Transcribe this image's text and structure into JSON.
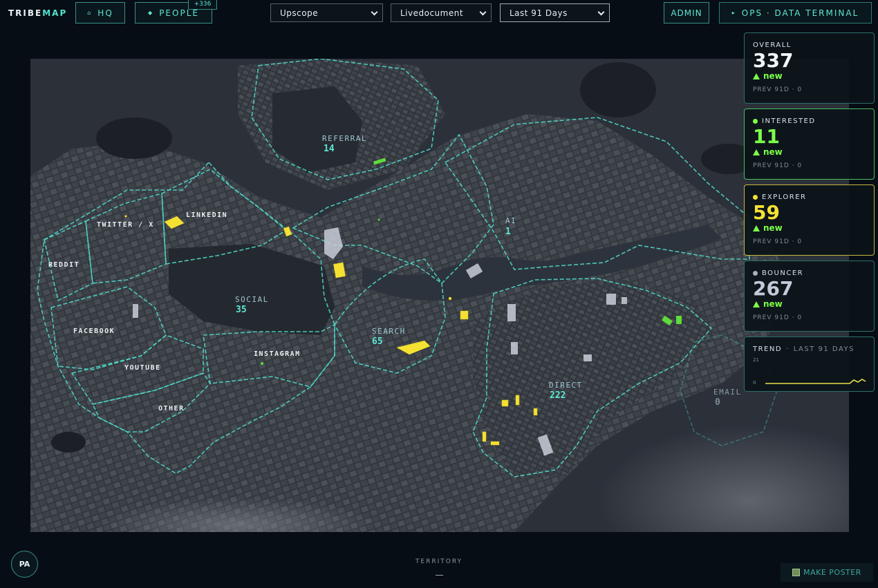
{
  "app": {
    "logo_primary": "TRIBE",
    "logo_accent": "MAP"
  },
  "nav": {
    "hq_label": "HQ",
    "people_label": "PEOPLE",
    "people_badge": "+336",
    "admin_label": "ADMIN",
    "ops_label": "OPS · DATA TERMINAL"
  },
  "filters": {
    "source": "Upscope",
    "document": "Livedocument",
    "range": "Last 91 Days"
  },
  "map": {
    "zones": [
      {
        "name": "REFERRAL",
        "count": "14"
      },
      {
        "name": "LINKEDIN",
        "count": ""
      },
      {
        "name": "TWITTER / X",
        "count": ""
      },
      {
        "name": "REDDIT",
        "count": ""
      },
      {
        "name": "FACEBOOK",
        "count": ""
      },
      {
        "name": "YOUTUBE",
        "count": ""
      },
      {
        "name": "OTHER",
        "count": ""
      },
      {
        "name": "INSTAGRAM",
        "count": ""
      },
      {
        "name": "SOCIAL",
        "count": "35"
      },
      {
        "name": "SEARCH",
        "count": "65"
      },
      {
        "name": "AI",
        "count": "1"
      },
      {
        "name": "DIRECT",
        "count": "222"
      },
      {
        "name": "EMAIL",
        "count": "0"
      }
    ]
  },
  "stats": {
    "overall": {
      "label": "OVERALL",
      "value": "337",
      "delta": "new",
      "prev": "PREV 91D · 0"
    },
    "interested": {
      "label": "INTERESTED",
      "value": "11",
      "delta": "new",
      "prev": "PREV 91D · 0",
      "color": "#7dff4a"
    },
    "explorer": {
      "label": "EXPLORER",
      "value": "59",
      "delta": "new",
      "prev": "PREV 91D · 0",
      "color": "#f4e132"
    },
    "bouncer": {
      "label": "BOUNCER",
      "value": "267",
      "delta": "new",
      "prev": "PREV 91D · 0",
      "color": "#a9b0be"
    },
    "trend": {
      "label": "TREND",
      "range": "LAST 91 DAYS",
      "ymax": "21",
      "ymin": "0"
    }
  },
  "footer": {
    "avatar_initials": "PA",
    "territory_label": "TERRITORY",
    "territory_value": "—",
    "poster_label": "MAKE POSTER"
  },
  "colors": {
    "accent": "#5fe6d4",
    "positive": "#7dff4a",
    "warning": "#f4e132"
  }
}
